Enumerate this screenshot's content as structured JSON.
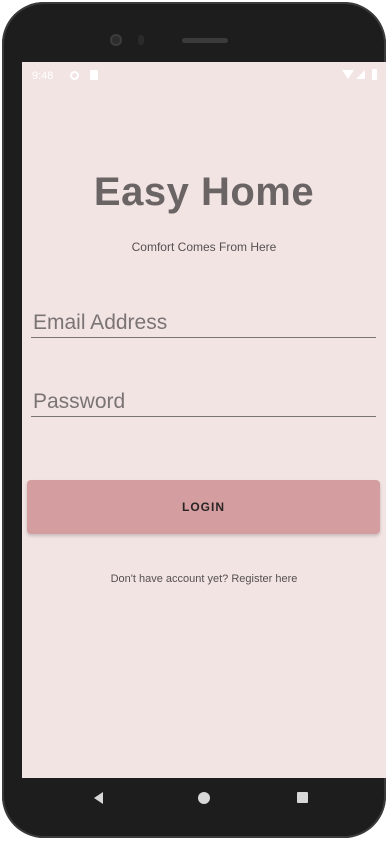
{
  "status_bar": {
    "time": "9:48",
    "left_icons": [
      "settings-icon",
      "sd-card-icon"
    ],
    "right_icons": [
      "wifi-icon",
      "signal-icon",
      "battery-icon"
    ]
  },
  "app": {
    "title": "Easy Home",
    "subtitle": "Comfort Comes From Here"
  },
  "form": {
    "email_placeholder": "Email Address",
    "email_value": "",
    "password_placeholder": "Password",
    "password_value": "",
    "login_label": "LOGIN",
    "register_text": "Don't have account yet? Register here"
  },
  "nav_bar": {
    "buttons": [
      "back-icon",
      "home-icon",
      "recents-icon"
    ]
  },
  "colors": {
    "screen_background": "#f3e4e4",
    "title_text": "#6a6464",
    "login_button": "#d49ea0",
    "device_frame": "#1d1d1d"
  }
}
